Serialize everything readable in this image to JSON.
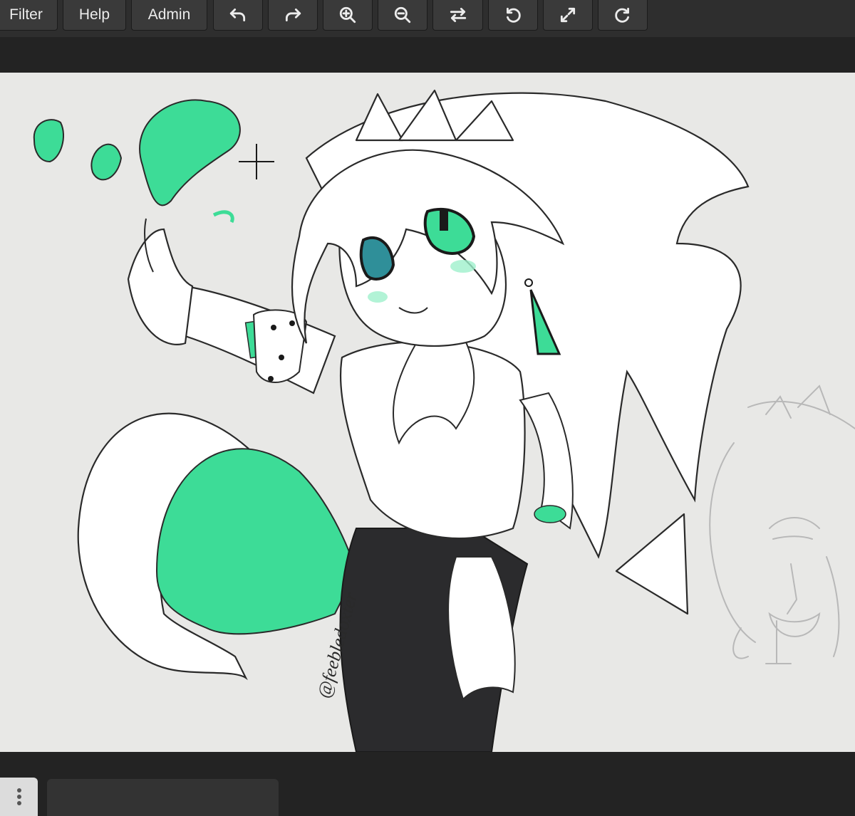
{
  "toolbar": {
    "menus": [
      {
        "label": "Filter"
      },
      {
        "label": "Help"
      },
      {
        "label": "Admin"
      }
    ],
    "tools": [
      {
        "icon": "undo-icon"
      },
      {
        "icon": "redo-icon"
      },
      {
        "icon": "zoom-in-icon"
      },
      {
        "icon": "zoom-out-icon"
      },
      {
        "icon": "flip-icon"
      },
      {
        "icon": "rotate-left-icon"
      },
      {
        "icon": "fullscreen-icon"
      },
      {
        "icon": "rotate-right-icon"
      }
    ]
  },
  "canvas": {
    "signature": "@feebledoxter",
    "background_color": "#e8e8e6",
    "accent_color": "#3ddc97",
    "outline_color": "#2a2a2a"
  },
  "bottom": {
    "handle_icon": "drag-handle-icon"
  }
}
